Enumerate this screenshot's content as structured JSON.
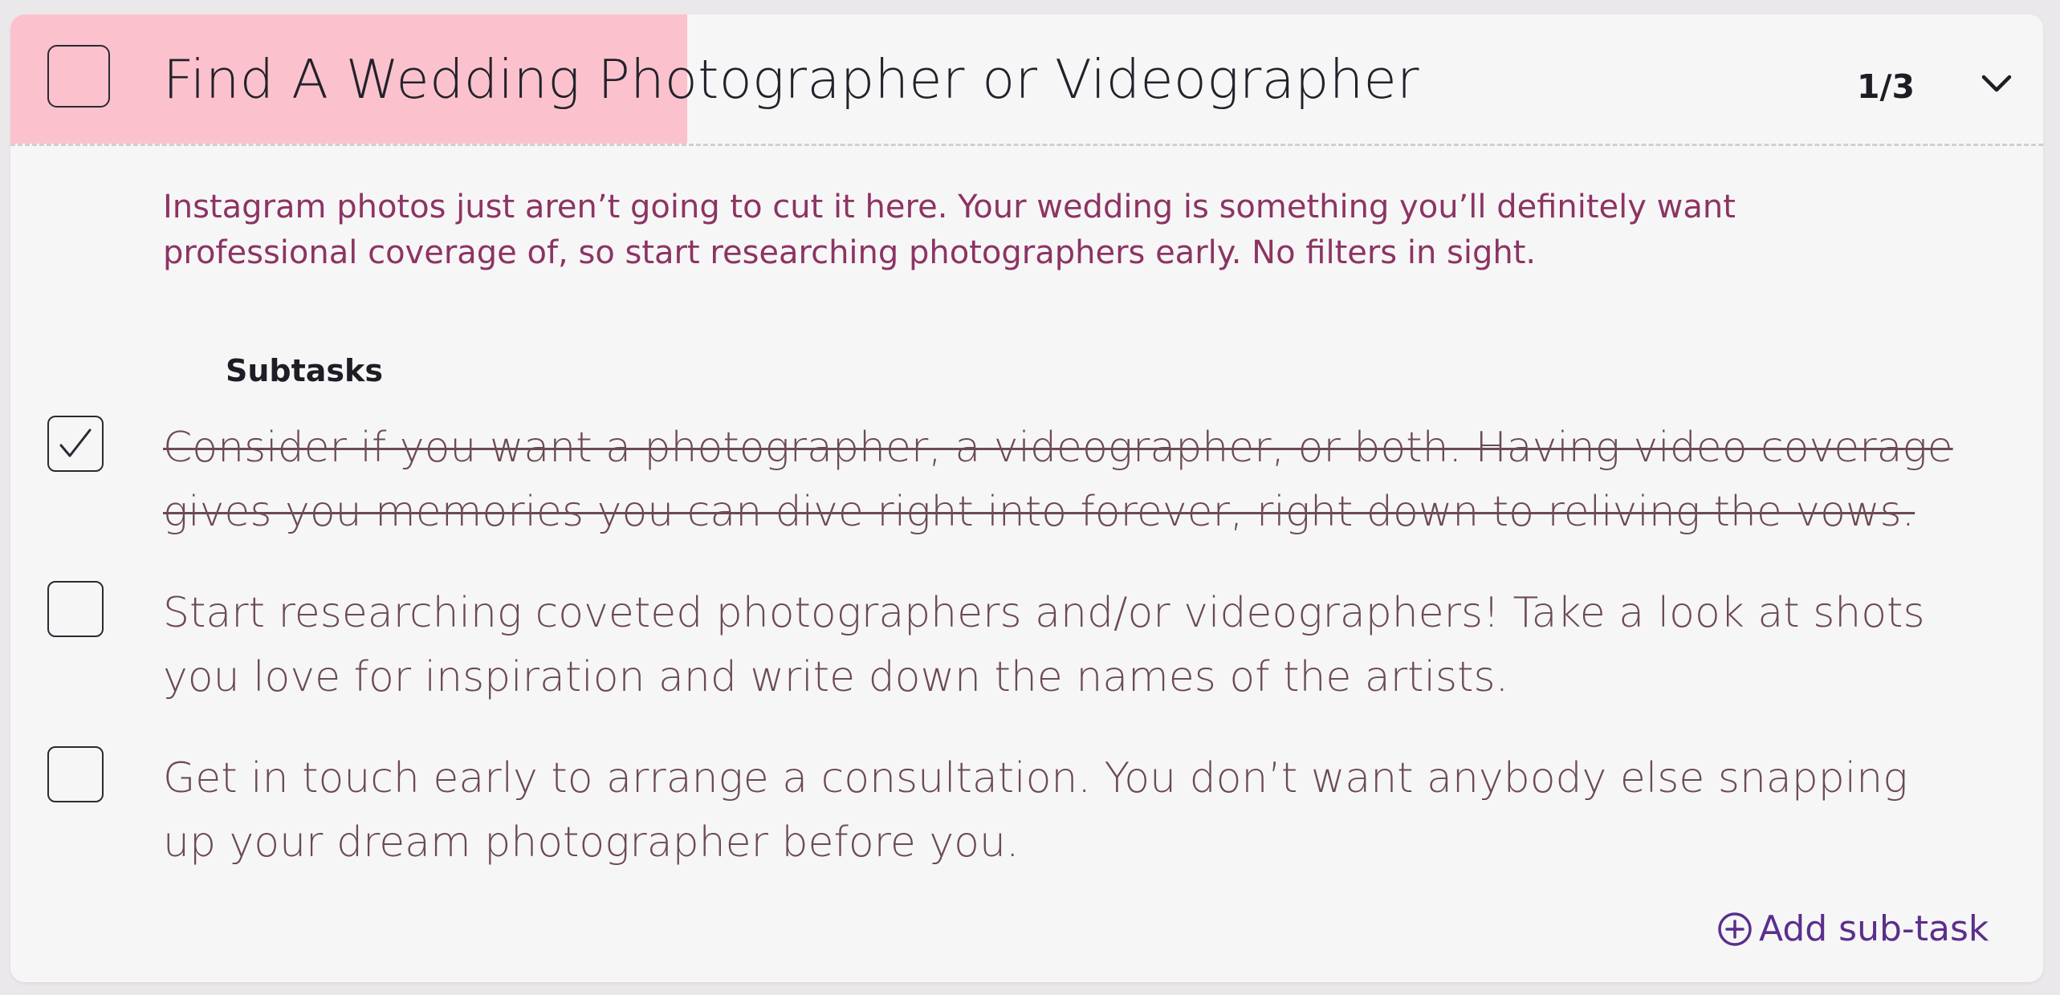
{
  "task": {
    "title": "Find A Wedding Photographer or Videographer",
    "counter": "1/3",
    "progress": 0.333,
    "description": "Instagram photos just aren’t going to cut it here. Your wedding is something you’ll definitely want professional coverage of, so start researching photographers early. No filters in sight."
  },
  "subtasks": {
    "heading": "Subtasks",
    "items": [
      {
        "text": "Consider if you want a photographer, a videographer, or both. Having video coverage gives you memories you can dive right into forever, right down to reliving the vows.",
        "done": true
      },
      {
        "text": "Start researching coveted photographers and/or videographers! Take a look at shots you love for inspiration and write down the names of the artists.",
        "done": false
      },
      {
        "text": "Get in touch early to arrange a consultation. You don’t want anybody else snapping up your dream photographer before you.",
        "done": false
      }
    ],
    "add_label": "Add sub-task"
  },
  "colors": {
    "progress_fill": "#fbc2cd",
    "description": "#8c3463",
    "subtask_text": "#6b4b52",
    "accent": "#5a2f8c"
  },
  "icons": {
    "expand": "chevron-down-icon",
    "add": "plus-circle-icon",
    "check": "checkmark-icon"
  }
}
